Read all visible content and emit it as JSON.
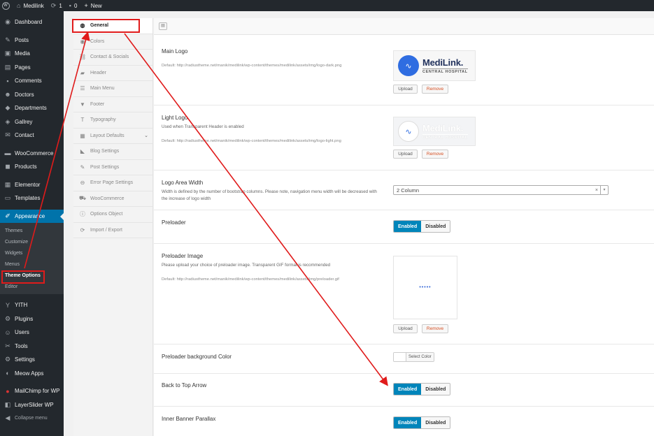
{
  "adminbar": {
    "site_name": "Medilink",
    "updates_count": "1",
    "comments_count": "0",
    "new_label": "New"
  },
  "menu": {
    "items": [
      {
        "label": "Dashboard",
        "icon": "dashboard-icon"
      },
      {
        "label": "Posts",
        "icon": "pin-icon"
      },
      {
        "label": "Media",
        "icon": "media-icon"
      },
      {
        "label": "Pages",
        "icon": "page-icon"
      },
      {
        "label": "Comments",
        "icon": "comment-icon"
      },
      {
        "label": "Doctors",
        "icon": "doctor-icon"
      },
      {
        "label": "Departments",
        "icon": "department-icon"
      },
      {
        "label": "Gallrey",
        "icon": "gallery-icon"
      },
      {
        "label": "Contact",
        "icon": "mail-icon"
      },
      {
        "label": "WooCommerce",
        "icon": "woocommerce-icon"
      },
      {
        "label": "Products",
        "icon": "product-icon"
      },
      {
        "label": "Elementor",
        "icon": "elementor-icon"
      },
      {
        "label": "Templates",
        "icon": "folder-icon"
      },
      {
        "label": "Appearance",
        "icon": "paintbrush-icon"
      },
      {
        "label": "YITH",
        "icon": "yith-icon"
      },
      {
        "label": "Plugins",
        "icon": "plugin-icon"
      },
      {
        "label": "Users",
        "icon": "users-icon"
      },
      {
        "label": "Tools",
        "icon": "tools-icon"
      },
      {
        "label": "Settings",
        "icon": "settings-icon"
      },
      {
        "label": "Meow Apps",
        "icon": "meow-icon"
      },
      {
        "label": "MailChimp for WP",
        "icon": "mailchimp-icon"
      },
      {
        "label": "LayerSlider WP",
        "icon": "layers-icon"
      },
      {
        "label": "Collapse menu",
        "icon": "collapse-icon"
      }
    ],
    "appearance_sub": [
      "Themes",
      "Customize",
      "Widgets",
      "Menus",
      "Theme Options",
      "Editor"
    ]
  },
  "options_nav": [
    {
      "label": "General",
      "icon": "globe-icon"
    },
    {
      "label": "Colors",
      "icon": "eye-icon"
    },
    {
      "label": "Contact & Socials",
      "icon": "link-icon"
    },
    {
      "label": "Header",
      "icon": "header-icon"
    },
    {
      "label": "Main Menu",
      "icon": "menu-icon"
    },
    {
      "label": "Footer",
      "icon": "footer-icon"
    },
    {
      "label": "Typography",
      "icon": "typography-icon"
    },
    {
      "label": "Layout Defaults",
      "icon": "grid-icon"
    },
    {
      "label": "Blog Settings",
      "icon": "tag-icon"
    },
    {
      "label": "Post Settings",
      "icon": "edit-icon"
    },
    {
      "label": "Error Page Settings",
      "icon": "error-icon"
    },
    {
      "label": "WooCommerce",
      "icon": "cart-icon"
    },
    {
      "label": "Options Object",
      "icon": "info-icon"
    },
    {
      "label": "Import / Export",
      "icon": "refresh-icon"
    }
  ],
  "options": {
    "main_logo": {
      "title": "Main Logo",
      "default": "Default: http://radiustheme.net/manik/medilink/wp-content/themes/medilink/assets/img/logo-dark.png",
      "logo_main": "MediLink.",
      "logo_sub": "CENTRAL HOSPITAL"
    },
    "light_logo": {
      "title": "Light Logo",
      "desc": "Used when Transparent Header is enabled",
      "default": "Default: http://radiustheme.net/manik/medilink/wp-content/themes/medilink/assets/img/logo-light.png",
      "logo_main": "MediLink.",
      "logo_sub": "CENTRAL HOSPITAL"
    },
    "logo_width": {
      "title": "Logo Area Width",
      "desc": "Width is defined by the number of bootstrap columns. Please note, navigation menu width will be decreased with the increase of logo width",
      "value": "2 Column"
    },
    "preloader": {
      "title": "Preloader"
    },
    "preloader_image": {
      "title": "Preloader Image",
      "desc": "Please upload your choice of preloader image. Transparent GIF format is recommended",
      "default": "Default: http://radiustheme.net/manik/medilink/wp-content/themes/medilink/assets/img/preloader.gif",
      "dots": "•••••"
    },
    "preloader_bg": {
      "title": "Preloader background Color",
      "button": "Select Color"
    },
    "back_to_top": {
      "title": "Back to Top Arrow"
    },
    "inner_banner": {
      "title": "Inner Banner Parallax"
    }
  },
  "buttons": {
    "upload": "Upload",
    "remove": "Remove",
    "enabled": "Enabled",
    "disabled": "Disabled"
  },
  "colors": {
    "accent": "#0073aa",
    "toggle_on": "#0085ba",
    "highlight": "#e01b1b",
    "logo_blue": "#2f6de1"
  }
}
